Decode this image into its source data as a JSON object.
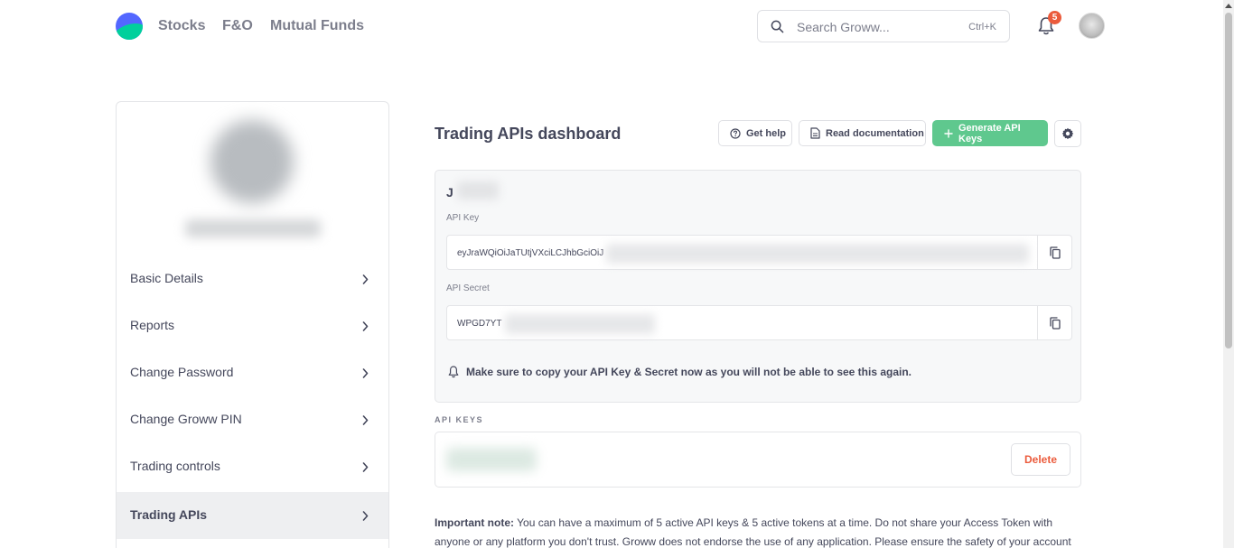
{
  "header": {
    "nav": [
      "Stocks",
      "F&O",
      "Mutual Funds"
    ],
    "search_placeholder": "Search Groww...",
    "search_shortcut": "Ctrl+K",
    "notification_count": "5"
  },
  "sidebar": {
    "items": [
      {
        "label": "Basic Details"
      },
      {
        "label": "Reports"
      },
      {
        "label": "Change Password"
      },
      {
        "label": "Change Groww PIN"
      },
      {
        "label": "Trading controls"
      },
      {
        "label": "Trading APIs",
        "active": true
      }
    ]
  },
  "main": {
    "title": "Trading APIs dashboard",
    "buttons": {
      "help": "Get help",
      "docs": "Read documentation",
      "generate": "Generate API Keys"
    },
    "key_card": {
      "name_initial": "J",
      "api_key_label": "API Key",
      "api_key_value": "eyJraWQiOiJaTUtjVXciLCJhbGciOiJ",
      "api_secret_label": "API Secret",
      "api_secret_value": "WPGD7YT",
      "warning": "Make sure to copy your API Key & Secret now as you will not be able to see this again."
    },
    "api_keys_section": {
      "label": "API KEYS",
      "delete_label": "Delete"
    },
    "note": {
      "bold": "Important note:",
      "text": " You can have a maximum of 5 active API keys & 5 active tokens at a time. Do not share your Access Token with anyone or any platform you don't trust. Groww does not endorse the use of any application. Please ensure the safety of your account"
    }
  },
  "colors": {
    "accent_green": "#5fc88e",
    "danger": "#eb5b3c",
    "text": "#44475b",
    "muted": "#7c7e8c"
  }
}
